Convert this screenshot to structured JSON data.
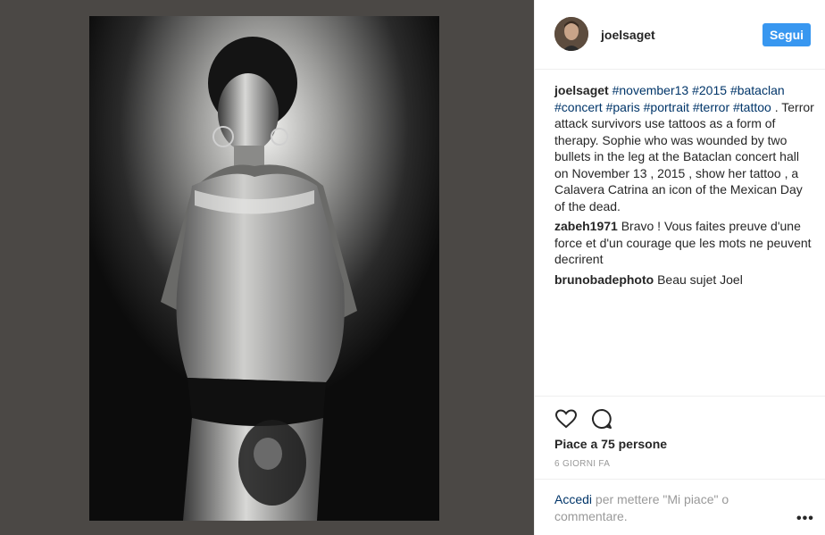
{
  "post": {
    "username": "joelsaget",
    "follow_label": "Segui"
  },
  "caption": {
    "user": "joelsaget",
    "hashtags": [
      "#november13",
      "#2015",
      "#bataclan",
      "#concert",
      "#paris",
      "#portrait",
      "#terror",
      "#tattoo"
    ],
    "text": " . Terror attack survivors use tattoos as a form of therapy. Sophie who was wounded by two bullets in the leg at the Bataclan concert hall on November 13 , 2015 , show her tattoo , a Calavera Catrina an icon of the Mexican Day of the dead."
  },
  "comments": [
    {
      "user": "zabeh1971",
      "text": " Bravo ! Vous faites preuve d'une force et d'un courage que les mots ne peuvent decrirent"
    },
    {
      "user": "brunobadephoto",
      "text": " Beau sujet Joel"
    }
  ],
  "likes_text": "Piace a 75 persone",
  "time_text": "6 GIORNI FA",
  "login": {
    "link": "Accedi",
    "text": " per mettere \"Mi piace\" o commentare."
  },
  "more_label": "•••",
  "colors": {
    "accent": "#3897f0",
    "hashtag": "#003569",
    "media_background": "#4b4845"
  }
}
